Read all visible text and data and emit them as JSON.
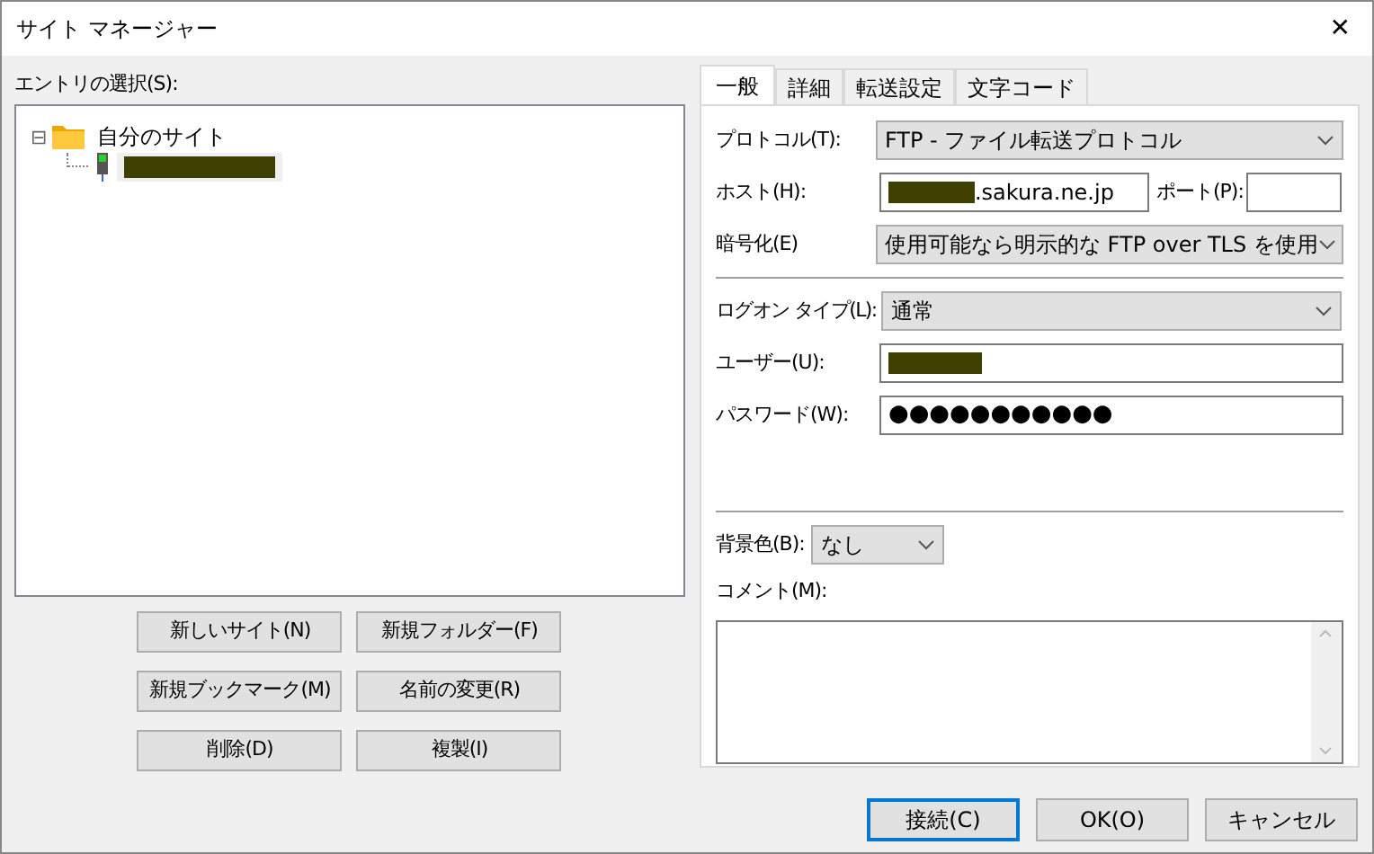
{
  "window": {
    "title": "サイト マネージャー",
    "close": "✕"
  },
  "entries": {
    "label": "エントリの選択(S):",
    "tree": [
      {
        "label": "自分のサイト",
        "expanded": true,
        "expander": "⊟",
        "children": [
          {
            "redacted": true
          }
        ]
      }
    ],
    "buttons": [
      {
        "label": "新しいサイト(N)"
      },
      {
        "label": "新規フォルダー(F)"
      },
      {
        "label": "新規ブックマーク(M)"
      },
      {
        "label": "名前の変更(R)"
      },
      {
        "label": "削除(D)"
      },
      {
        "label": "複製(I)"
      }
    ]
  },
  "tabs": [
    {
      "label": "一般",
      "selected": true
    },
    {
      "label": "詳細",
      "selected": false
    },
    {
      "label": "転送設定",
      "selected": false
    },
    {
      "label": "文字コード",
      "selected": false
    }
  ],
  "general": {
    "protocol": {
      "label": "プロトコル(T):",
      "value": "FTP - ファイル転送プロトコル"
    },
    "host": {
      "label": "ホスト(H):",
      "value": ".sakura.ne.jp",
      "redacted_prefix": true
    },
    "port": {
      "label": "ポート(P):"
    },
    "encryption": {
      "label": "暗号化(E)",
      "value": "使用可能なら明示的な FTP over TLS を使用"
    },
    "logon_type": {
      "label": "ログオン タイプ(L):",
      "value": "通常"
    },
    "user": {
      "label": "ユーザー(U):",
      "redacted": true
    },
    "password": {
      "label": "パスワード(W):",
      "value": "●●●●●●●●●●●"
    },
    "background_color": {
      "label": "背景色(B):",
      "value": "なし"
    },
    "comment": {
      "label": "コメント(M):"
    }
  },
  "footer_buttons": [
    {
      "label": "接続(C)",
      "default": true
    },
    {
      "label": "OK(O)",
      "default": false
    },
    {
      "label": "キャンセル",
      "default": false
    }
  ]
}
